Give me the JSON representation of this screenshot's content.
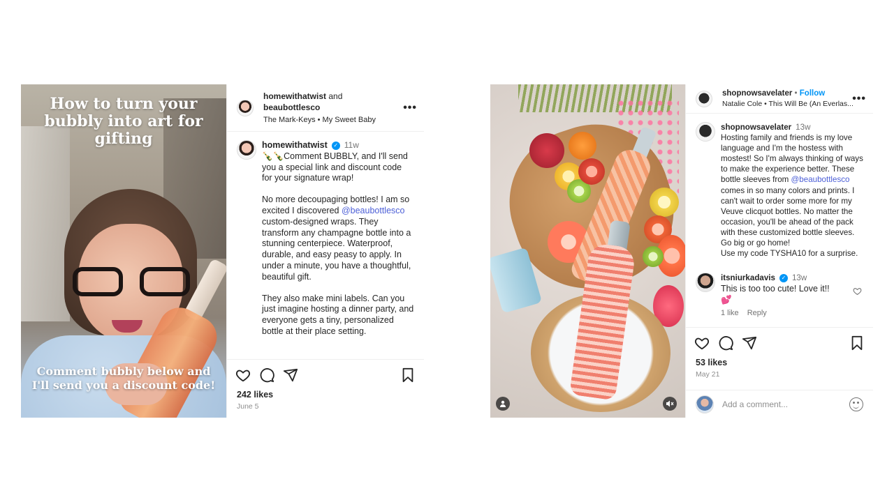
{
  "post1": {
    "overlay_title": "How to turn your bubbly into art for gifting",
    "overlay_bottom": "Comment bubbly below and I'll send you a discount code!",
    "header": {
      "user1": "homewithatwist",
      "and": " and",
      "user2": "beaubottlesco",
      "audio": "The Mark-Keys • My Sweet Baby"
    },
    "caption": {
      "author": "homewithatwist",
      "time": "11w",
      "emoji": "🍾🍾",
      "para1": "Comment BUBBLY, and I'll send you a special link and discount code for your signature wrap!",
      "para2_a": "No more decoupaging bottles!  I am so excited I discovered ",
      "para2_mention": "@beaubottlesco",
      "para2_b": " custom-designed wraps. They transform any champagne bottle into a stunning centerpiece. Waterproof, durable, and easy peasy to apply. In under a minute, you have a thoughtful, beautiful gift.",
      "para3": "They also make mini labels. Can you just imagine hosting a dinner party, and everyone gets a tiny, personalized bottle at their place setting."
    },
    "likes": "242 likes",
    "date": "June 5"
  },
  "post2": {
    "header": {
      "user": "shopnowsavelater",
      "separator": " • ",
      "follow": "Follow",
      "audio": "Natalie Cole • This Will Be (An Everlas..."
    },
    "caption": {
      "author": "shopnowsavelater",
      "time": "13w",
      "text_a": "Hosting family and friends is my love language and I'm the hostess with mostest! So I'm always thinking of ways to make the experience better. These bottle sleeves from ",
      "mention": "@beaubottlesco",
      "text_b": " comes in so many colors and prints. I can't wait to order some more for my Veuve clicquot bottles. No matter the occasion, you'll be ahead of the pack with these customized bottle sleeves. Go big or go home!",
      "text_c": "Use my code TYSHA10 for a surprise."
    },
    "comment": {
      "author": "itsniurkadavis",
      "time": "13w",
      "text": "This is too too cute! Love it!! 💕",
      "likes": "1 like",
      "reply": "Reply"
    },
    "likes": "53 likes",
    "date": "May 21",
    "add_comment_placeholder": "Add a comment..."
  },
  "icons": {
    "heart": "heart-icon",
    "comment": "comment-icon",
    "share": "share-icon",
    "save": "bookmark-icon",
    "more": "more-icon",
    "emoji": "emoji-icon",
    "mute": "muted-speaker-icon",
    "tag": "user-tag-icon"
  },
  "colors": {
    "link_blue": "#0095f6",
    "mention": "#4c5fd7",
    "text": "#262626",
    "muted": "#737373"
  }
}
